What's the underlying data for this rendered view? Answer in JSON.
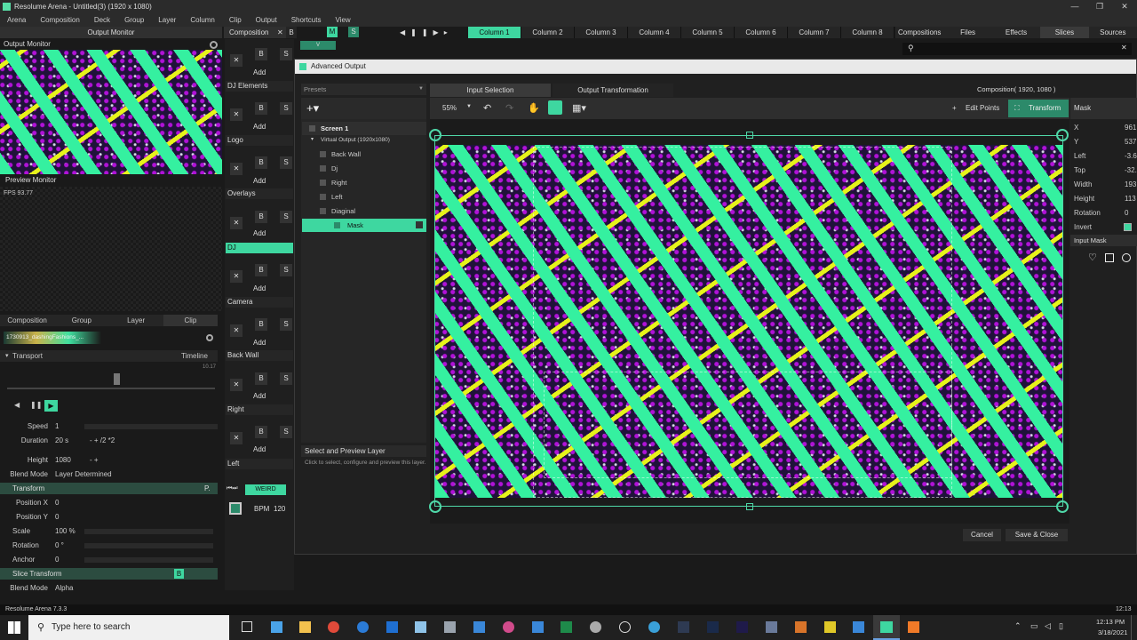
{
  "window": {
    "title": "Resolume Arena - Untitled(3) (1920 x 1080)",
    "min": "—",
    "max": "❐",
    "close": "✕"
  },
  "menu": [
    "Arena",
    "Composition",
    "Deck",
    "Group",
    "Layer",
    "Column",
    "Clip",
    "Output",
    "Shortcuts",
    "View"
  ],
  "output_monitor": {
    "title": "Output Monitor"
  },
  "preview_monitor": {
    "title": "Preview Monitor",
    "fps": "FPS 93.77"
  },
  "composition_tab": {
    "label": "Composition",
    "close": "✕",
    "b": "B",
    "m": "M",
    "s": "S",
    "v": "V"
  },
  "columns": [
    "Column 1",
    "Column 2",
    "Column 3",
    "Column 4",
    "Column 5",
    "Column 6",
    "Column 7",
    "Column 8"
  ],
  "right_tabs": [
    "Compositions",
    "Files",
    "Effects",
    "Slices",
    "Sources"
  ],
  "layers": [
    {
      "name": "DJ Elements"
    },
    {
      "name": "Logo"
    },
    {
      "name": "Overlays"
    },
    {
      "name": "DJ"
    },
    {
      "name": "Camera"
    },
    {
      "name": "Back Wall"
    },
    {
      "name": "Right"
    },
    {
      "name": "Left"
    }
  ],
  "layer_controls": {
    "x": "✕",
    "b": "B",
    "s": "S",
    "add": "Add"
  },
  "deck": {
    "weird": "WEIRD",
    "bpm_label": "BPM",
    "bpm": "120"
  },
  "bottom_tabs": [
    "Composition",
    "Group",
    "Layer",
    "Clip"
  ],
  "clip": {
    "name": "1730913_dashingFashions_...",
    "transport": "Transport",
    "timeline": "Timeline",
    "time": "10.17"
  },
  "props": {
    "speed_label": "Speed",
    "speed": "1",
    "duration_label": "Duration",
    "duration": "20 s",
    "dur_ops": "-  +  /2  *2",
    "height_label": "Height",
    "height": "1080",
    "height_ops": "-  +",
    "blend_label": "Blend Mode",
    "blend": "Layer Determined",
    "transform": "Transform",
    "p": "P.",
    "posx_label": "Position X",
    "posx": "0",
    "posy_label": "Position Y",
    "posy": "0",
    "scale_label": "Scale",
    "scale": "100 %",
    "rotation_label": "Rotation",
    "rotation": "0 °",
    "anchor_label": "Anchor",
    "anchor": "0",
    "slice_transform": "Slice Transform",
    "blend2_label": "Blend Mode",
    "blend2": "Alpha"
  },
  "status": {
    "version": "Resolume Arena 7.3.3",
    "time": "12:13"
  },
  "dialog": {
    "title": "Advanced Output",
    "presets": "Presets",
    "tab_input": "Input Selection",
    "tab_output": "Output Transformation",
    "comp_size": "Composition( 1920, 1080 )",
    "zoom": "55%",
    "edit_points": "Edit Points",
    "transform": "Transform",
    "tree": [
      "Screen 1",
      "Virtual Output (1920x1080)",
      "Back Wall",
      "Dj",
      "Right",
      "Left",
      "Diaginal",
      "Mask"
    ],
    "help_title": "Select and Preview Layer",
    "help_text": "Click to select, configure and preview this layer.",
    "cancel": "Cancel",
    "save": "Save & Close",
    "mask_title": "Mask",
    "mask_props": [
      [
        "X",
        "961"
      ],
      [
        "Y",
        "537"
      ],
      [
        "Left",
        "-3.6"
      ],
      [
        "Top",
        "-32."
      ],
      [
        "Width",
        "193"
      ],
      [
        "Height",
        "113"
      ],
      [
        "Rotation",
        "0"
      ],
      [
        "Invert",
        ""
      ]
    ],
    "input_mask": "Input Mask"
  },
  "taskbar": {
    "search": "Type here to search",
    "time": "12:13 PM",
    "date": "3/18/2021"
  }
}
